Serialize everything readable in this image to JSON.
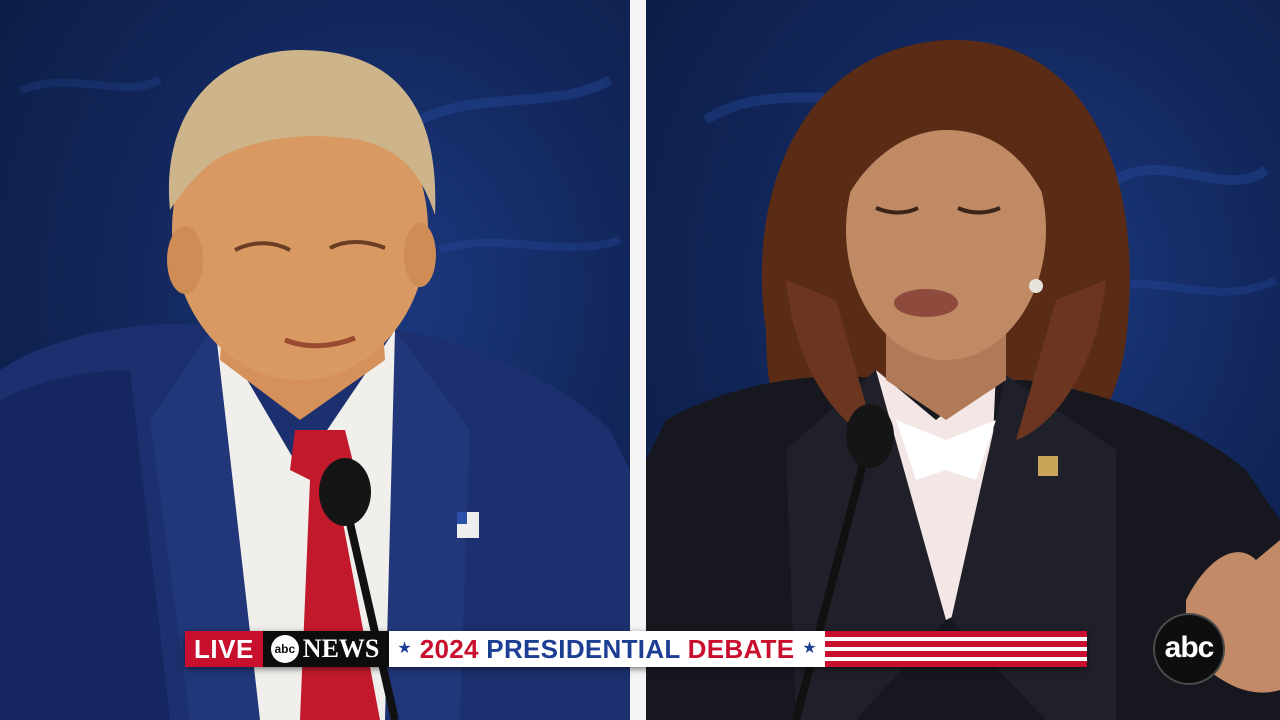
{
  "broadcast": {
    "live_label": "LIVE",
    "network_logo_text": "abc",
    "network_name": "NEWS",
    "title_part_1": "2024",
    "title_part_2": "PRESIDENTIAL",
    "title_part_3": "DEBATE",
    "corner_bug": "abc"
  },
  "colors": {
    "accent_red": "#c8102e",
    "accent_blue": "#1c3f94",
    "backdrop_blue": "#12275c"
  },
  "icons": {
    "stars": [
      "star-icon",
      "star-icon"
    ],
    "flag_pin": "flag-pin-icon"
  }
}
